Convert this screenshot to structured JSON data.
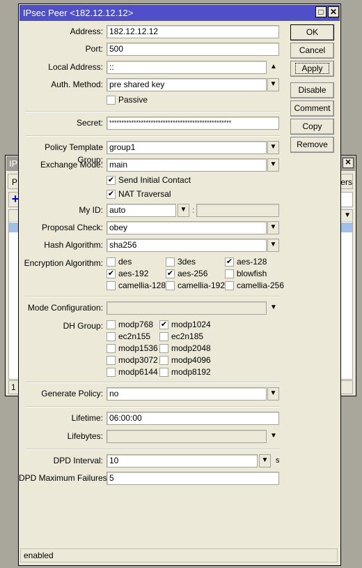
{
  "background_window": {
    "title_fragment": "IPs",
    "tab_left_fragment": "P",
    "tab_right_fragment": "ers",
    "status_fragment": "1 i"
  },
  "dialog": {
    "title": "IPsec Peer <182.12.12.12>",
    "status": "enabled"
  },
  "buttons": {
    "ok": "OK",
    "cancel": "Cancel",
    "apply": "Apply",
    "disable": "Disable",
    "comment": "Comment",
    "copy": "Copy",
    "remove": "Remove"
  },
  "form": {
    "address": {
      "label": "Address:",
      "value": "182.12.12.12"
    },
    "port": {
      "label": "Port:",
      "value": "500"
    },
    "local_address": {
      "label": "Local Address:",
      "value": "::"
    },
    "auth_method": {
      "label": "Auth. Method:",
      "value": "pre shared key"
    },
    "passive": {
      "label": "Passive",
      "checked": false
    },
    "secret": {
      "label": "Secret:",
      "value": "**************************************************"
    },
    "policy_template_group": {
      "label": "Policy Template Group:",
      "value": "group1"
    },
    "exchange_mode": {
      "label": "Exchange Mode:",
      "value": "main"
    },
    "send_initial_contact": {
      "label": "Send Initial Contact",
      "checked": true
    },
    "nat_traversal": {
      "label": "NAT Traversal",
      "checked": true
    },
    "my_id": {
      "label": "My ID:",
      "value": "auto",
      "separator": ":",
      "extra": ""
    },
    "proposal_check": {
      "label": "Proposal Check:",
      "value": "obey"
    },
    "hash_algorithm": {
      "label": "Hash Algorithm:",
      "value": "sha256"
    },
    "encryption_algorithm": {
      "label": "Encryption Algorithm:",
      "options": [
        {
          "name": "des",
          "checked": false
        },
        {
          "name": "3des",
          "checked": false
        },
        {
          "name": "aes-128",
          "checked": true
        },
        {
          "name": "aes-192",
          "checked": true
        },
        {
          "name": "aes-256",
          "checked": true
        },
        {
          "name": "blowfish",
          "checked": false
        },
        {
          "name": "camellia-128",
          "checked": false
        },
        {
          "name": "camellia-192",
          "checked": false
        },
        {
          "name": "camellia-256",
          "checked": false
        }
      ]
    },
    "mode_configuration": {
      "label": "Mode Configuration:",
      "value": ""
    },
    "dh_group": {
      "label": "DH Group:",
      "options": [
        {
          "name": "modp768",
          "checked": false
        },
        {
          "name": "modp1024",
          "checked": true
        },
        {
          "name": "ec2n155",
          "checked": false
        },
        {
          "name": "ec2n185",
          "checked": false
        },
        {
          "name": "modp1536",
          "checked": false
        },
        {
          "name": "modp2048",
          "checked": false
        },
        {
          "name": "modp3072",
          "checked": false
        },
        {
          "name": "modp4096",
          "checked": false
        },
        {
          "name": "modp6144",
          "checked": false
        },
        {
          "name": "modp8192",
          "checked": false
        }
      ]
    },
    "generate_policy": {
      "label": "Generate Policy:",
      "value": "no"
    },
    "lifetime": {
      "label": "Lifetime:",
      "value": "06:00:00"
    },
    "lifebytes": {
      "label": "Lifebytes:",
      "value": ""
    },
    "dpd_interval": {
      "label": "DPD Interval:",
      "value": "10",
      "unit": "s"
    },
    "dpd_max_failures": {
      "label": "DPD Maximum Failures:",
      "value": "5"
    }
  },
  "colors": {
    "title_bar": "#4f50c8",
    "window_bg": "#ece9d8",
    "desktop": "#a9a79b",
    "selected_row": "#a0c0e8"
  }
}
